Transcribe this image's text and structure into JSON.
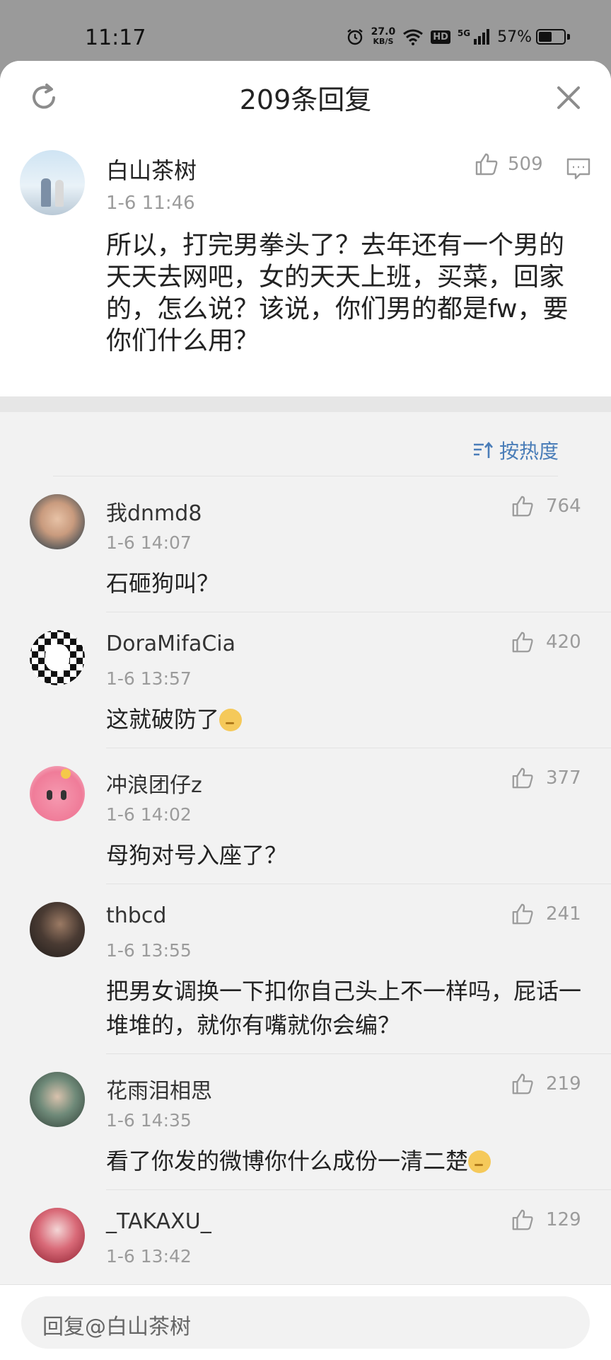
{
  "status_bar": {
    "time": "11:17",
    "net_speed_value": "27.0",
    "net_speed_unit": "KB/S",
    "hd": "HD",
    "network": "5G",
    "battery": "57%",
    "battery_level": 0.57,
    "icons": [
      "alarm-icon",
      "wifi-icon",
      "signal-icon",
      "battery-icon"
    ]
  },
  "header": {
    "title": "209条回复",
    "refresh_icon": "refresh-icon",
    "close_icon": "close-icon"
  },
  "main_post": {
    "author": "白山茶树",
    "time": "1-6 11:46",
    "likes": "509",
    "text": "所以，打完男拳头了？去年还有一个男的天天去网吧，女的天天上班，买菜，回家的，怎么说？该说，你们男的都是fw，要你们什么用？"
  },
  "sort": {
    "label": "按热度"
  },
  "replies": [
    {
      "name": "我dnmd8",
      "time": "1-6 14:07",
      "likes": "764",
      "text": "石砸狗叫？"
    },
    {
      "name": "DoraMifaCia",
      "time": "1-6 13:57",
      "likes": "420",
      "text": "这就破防了"
    },
    {
      "name": "冲浪团仔z",
      "time": "1-6 14:02",
      "likes": "377",
      "text": "母狗对号入座了？"
    },
    {
      "name": "thbcd",
      "time": "1-6 13:55",
      "likes": "241",
      "text": "把男女调换一下扣你自己头上不一样吗，屁话一堆堆的，就你有嘴就你会编？"
    },
    {
      "name": "花雨泪相思",
      "time": "1-6 14:35",
      "likes": "219",
      "text": "看了你发的微博你什么成份一清二楚"
    },
    {
      "name": "_TAKAXU_",
      "time": "1-6 13:42",
      "likes": "129",
      "text": ""
    }
  ],
  "reply_input": {
    "placeholder": "回复@白山茶树"
  }
}
